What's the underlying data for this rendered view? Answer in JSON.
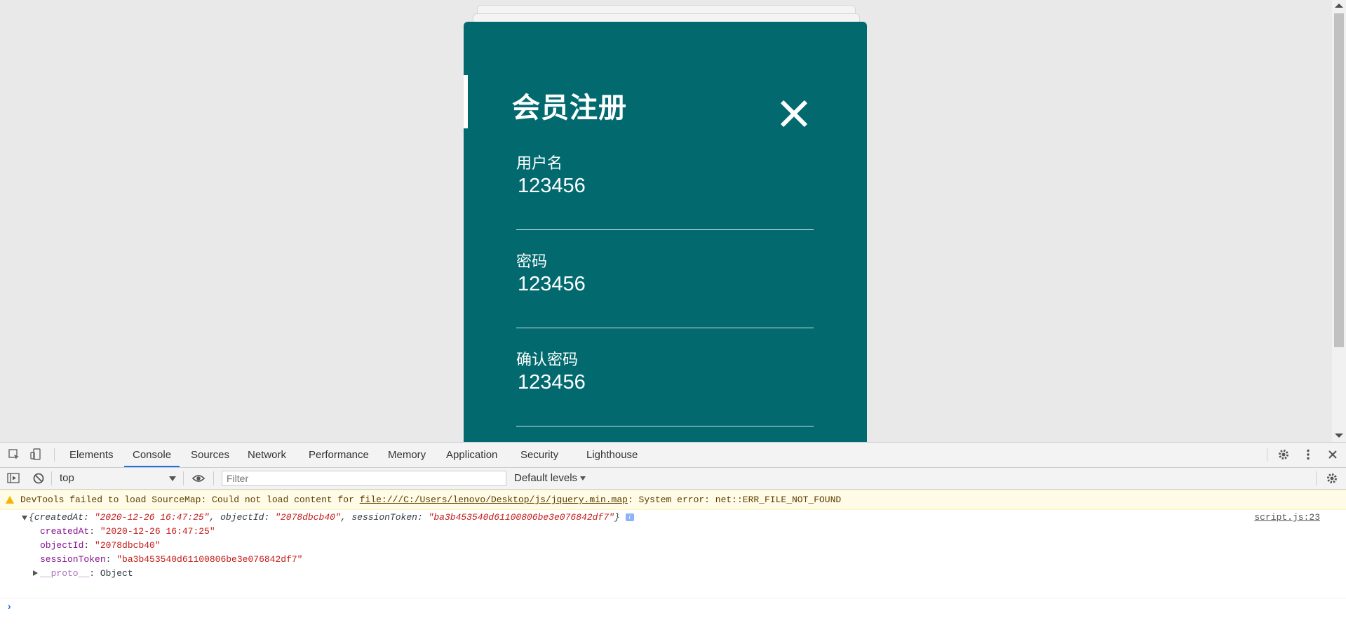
{
  "page": {
    "modal": {
      "title": "会员注册",
      "fields": [
        {
          "label": "用户名",
          "value": "123456"
        },
        {
          "label": "密码",
          "value": "123456"
        },
        {
          "label": "确认密码",
          "value": "123456"
        }
      ],
      "colors": {
        "panel": "#026a6f",
        "text": "#ffffff"
      }
    }
  },
  "devtools": {
    "tabs": [
      "Elements",
      "Console",
      "Sources",
      "Network",
      "Performance",
      "Memory",
      "Application",
      "Security",
      "Lighthouse"
    ],
    "active_tab": "Console",
    "context": "top",
    "filter_placeholder": "Filter",
    "levels": "Default levels",
    "console": {
      "warning": {
        "prefix": "DevTools failed to load SourceMap: Could not load content for ",
        "link": "file:///C:/Users/lenovo/Desktop/js/jquery.min.map",
        "suffix": ": System error: net::ERR_FILE_NOT_FOUND"
      },
      "object_summary": {
        "k1": "createdAt",
        "v1": "\"2020-12-26 16:47:25\"",
        "k2": "objectId",
        "v2": "\"2078dbcb40\"",
        "k3": "sessionToken",
        "v3": "\"ba3b453540d61100806be3e076842df7\""
      },
      "source": "script.js:23",
      "props": [
        {
          "key": "createdAt",
          "value": "\"2020-12-26 16:47:25\""
        },
        {
          "key": "objectId",
          "value": "\"2078dbcb40\""
        },
        {
          "key": "sessionToken",
          "value": "\"ba3b453540d61100806be3e076842df7\""
        }
      ],
      "proto": {
        "key": "__proto__",
        "value": "Object"
      }
    }
  }
}
